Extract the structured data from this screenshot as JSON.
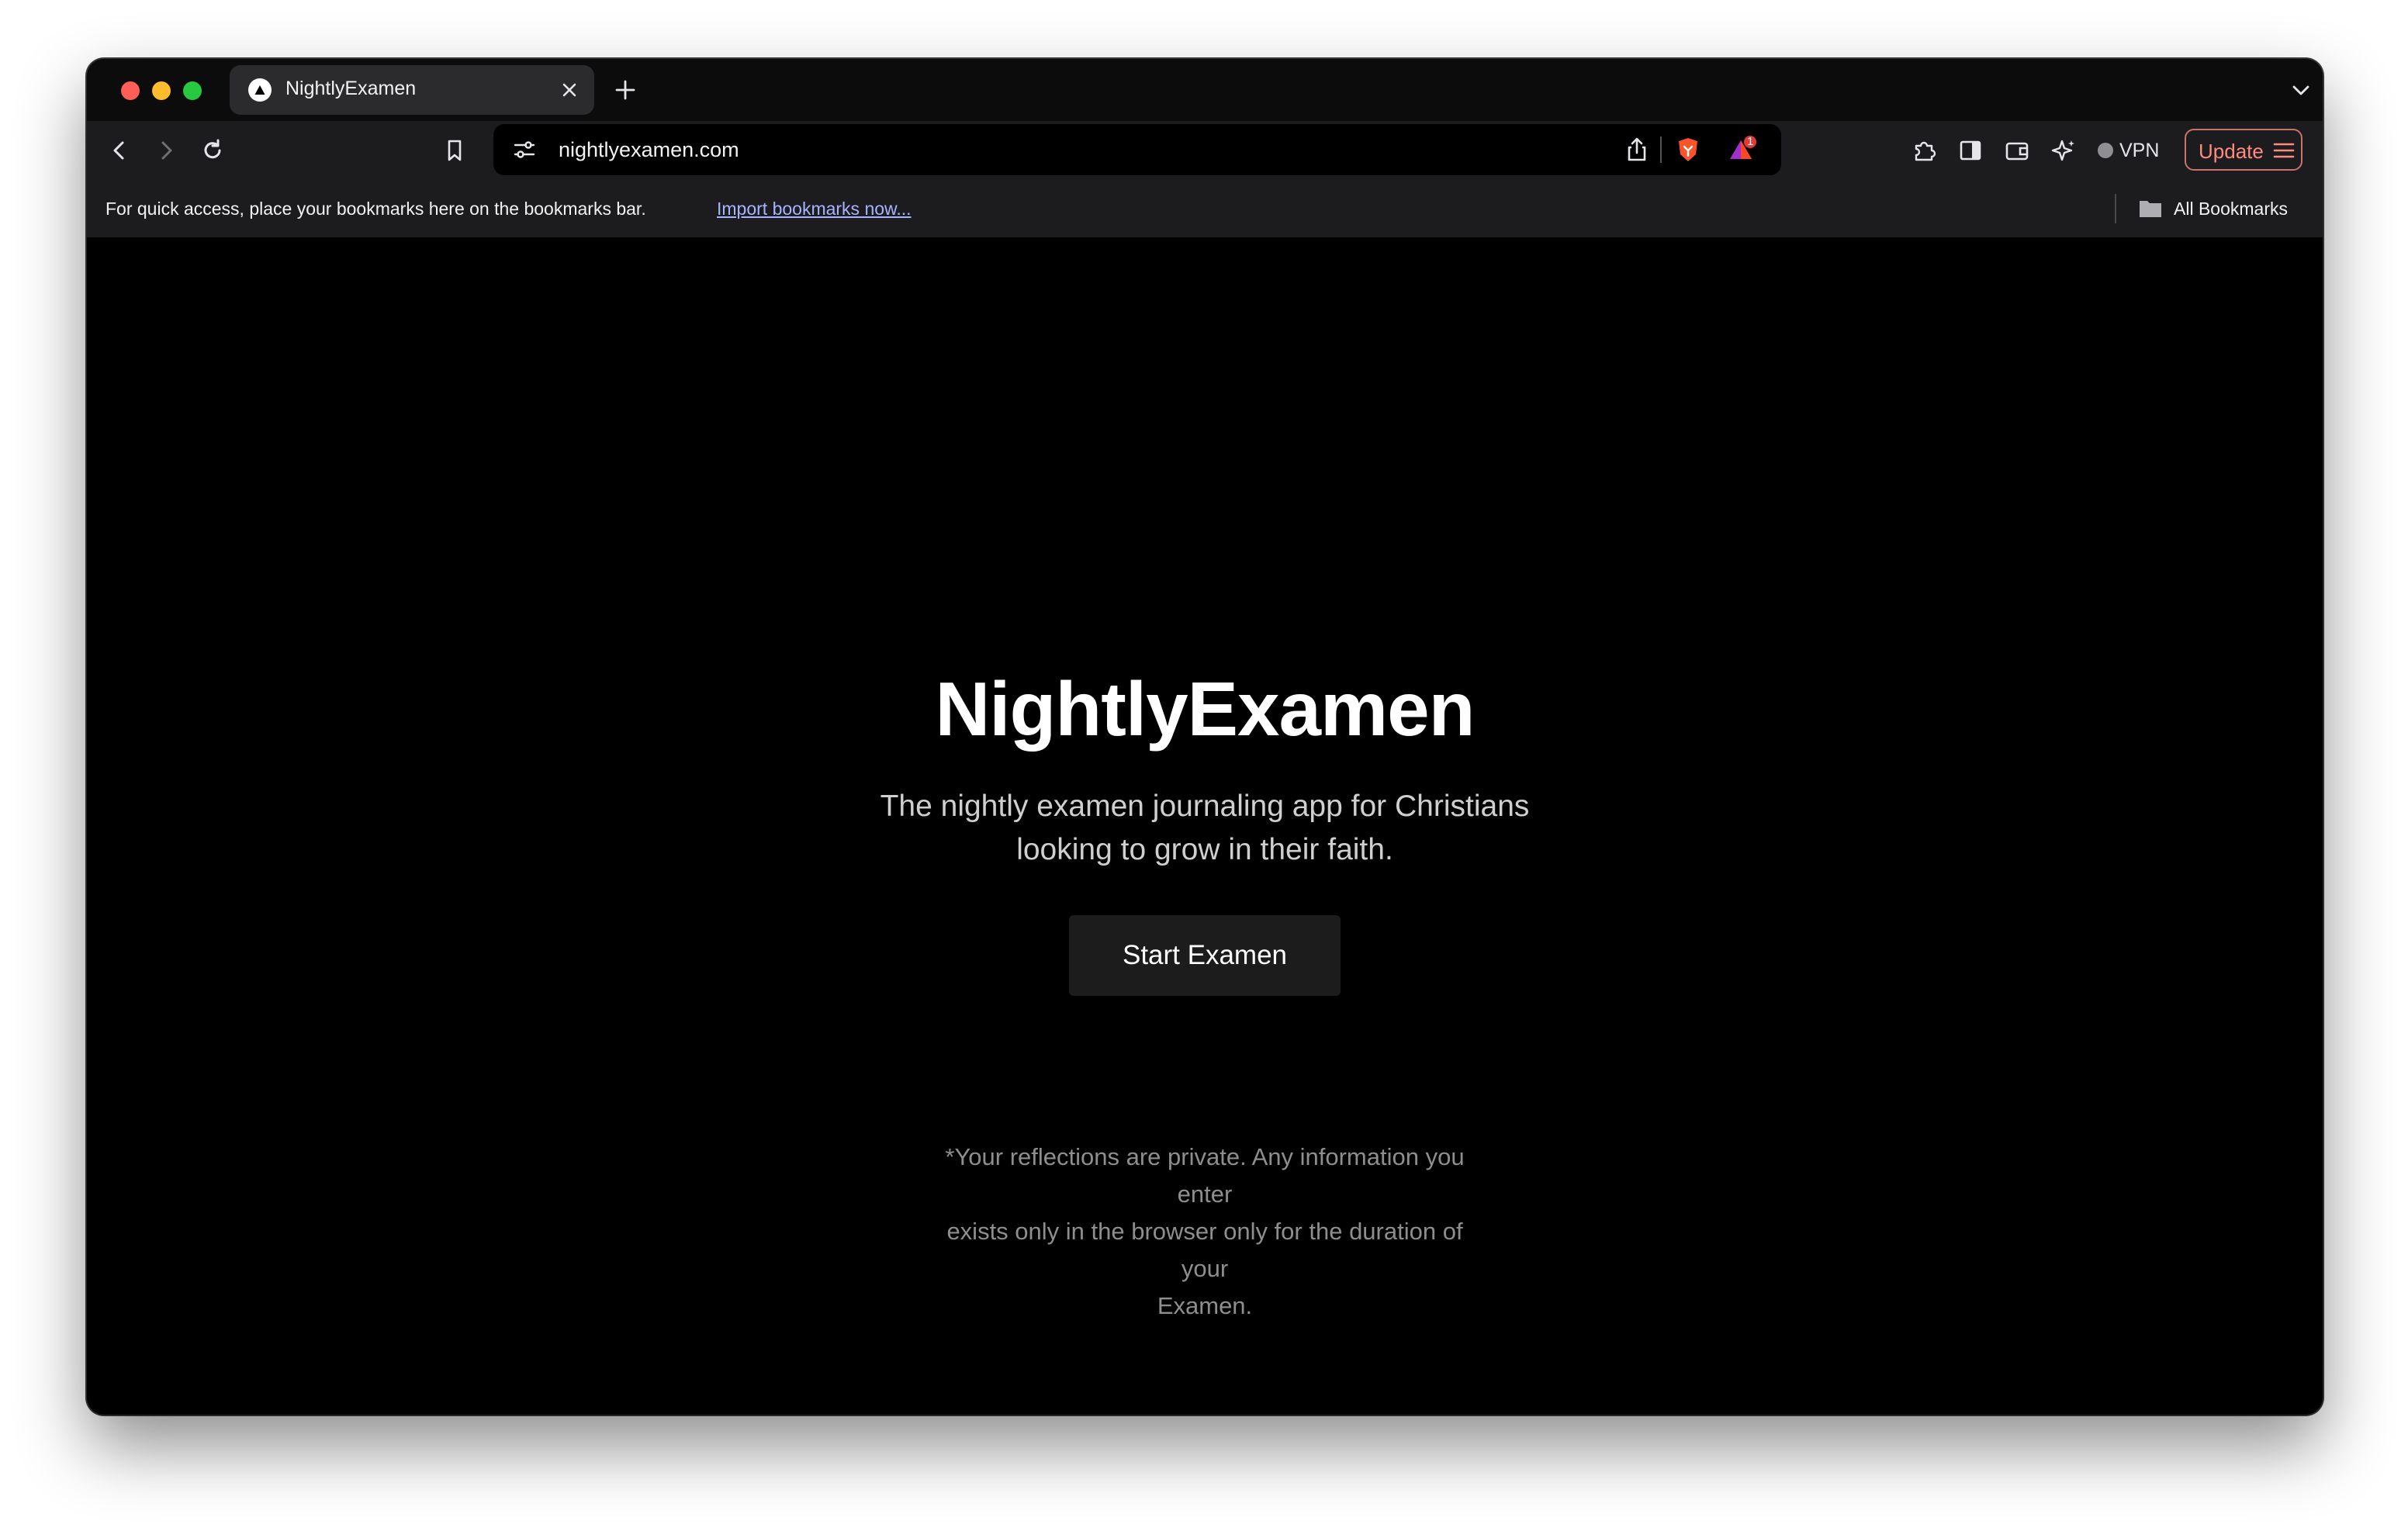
{
  "tab": {
    "title": "NightlyExamen"
  },
  "address_bar": {
    "url": "nightlyexamen.com",
    "notification_count": "1"
  },
  "toolbar": {
    "vpn_label": "VPN",
    "update_label": "Update"
  },
  "bookmarks_bar": {
    "message": "For quick access, place your bookmarks here on the bookmarks bar.",
    "import_link": "Import bookmarks now...",
    "all_bookmarks": "All Bookmarks"
  },
  "page": {
    "title": "NightlyExamen",
    "subtitle_line1": "The nightly examen journaling app for Christians",
    "subtitle_line2": "looking to grow in their faith.",
    "start_button": "Start Examen",
    "privacy_line1": "*Your reflections are private. Any information you enter",
    "privacy_line2": "exists only in the browser only for the duration of your",
    "privacy_line3": "Examen."
  },
  "colors": {
    "page_background": "#000000",
    "button_background": "#1c1c1c",
    "update_accent": "#ff8a80",
    "link": "#a7b4ff"
  },
  "icons": [
    "close-icon",
    "plus-icon",
    "chevron-down-icon",
    "back-arrow-icon",
    "forward-arrow-icon",
    "reload-icon",
    "bookmark-icon",
    "site-settings-icon",
    "share-icon",
    "brave-shields-icon",
    "brave-rewards-icon",
    "extensions-icon",
    "sidebar-icon",
    "wallet-icon",
    "leo-ai-icon",
    "menu-icon",
    "folder-icon"
  ]
}
